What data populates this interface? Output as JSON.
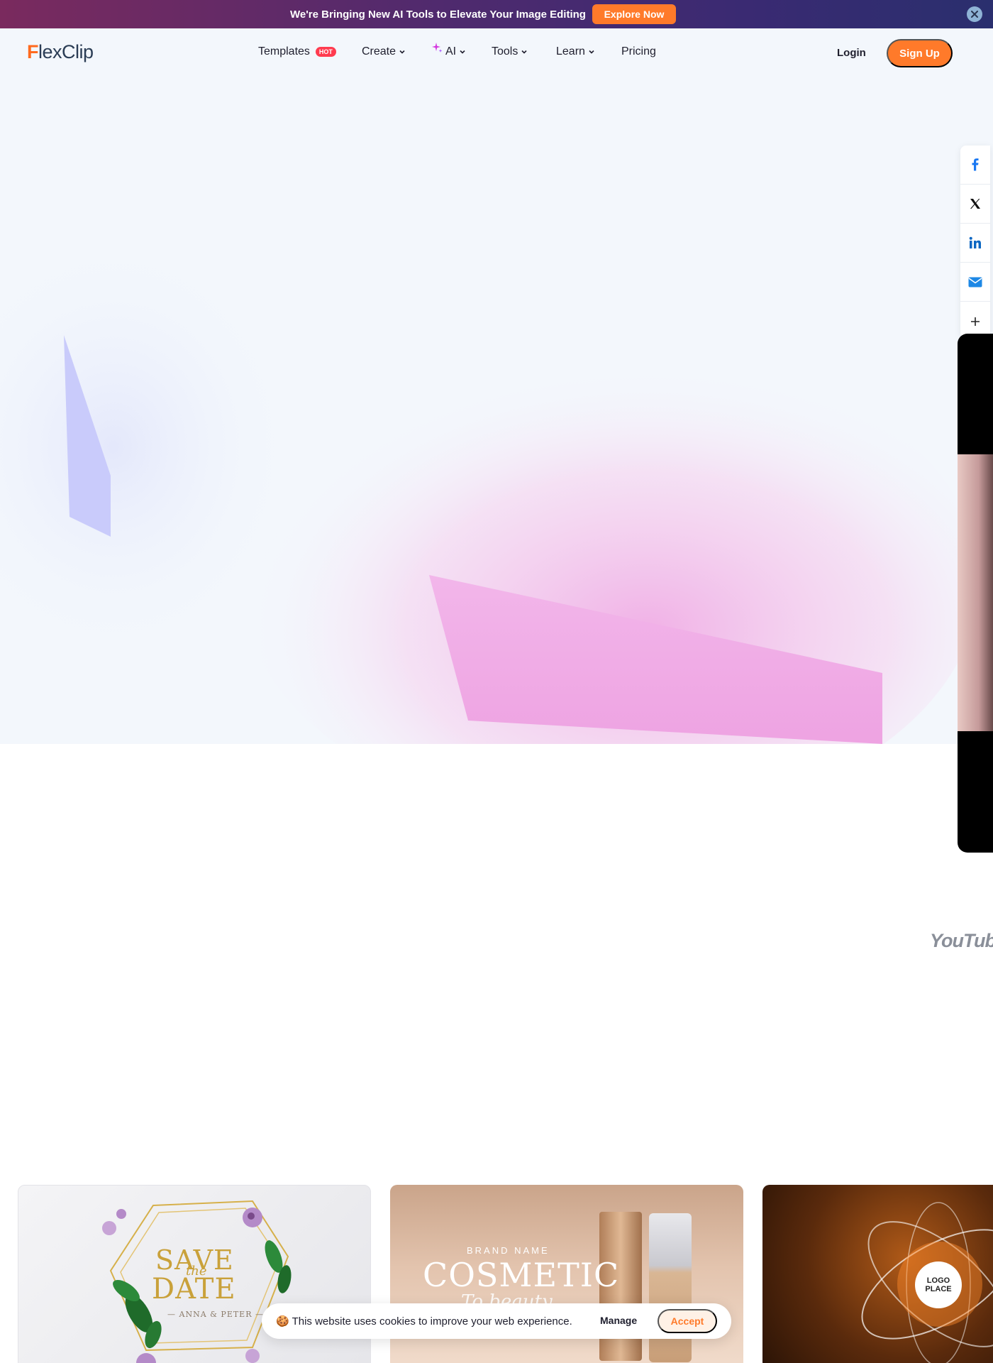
{
  "promo": {
    "text": "We're Bringing New AI Tools to Elevate Your Image Editing",
    "cta": "Explore Now"
  },
  "nav": {
    "logo_first": "F",
    "logo_rest": "lexClip",
    "items": [
      {
        "label": "Templates",
        "badge": "HOT"
      },
      {
        "label": "Create"
      },
      {
        "label": "AI"
      },
      {
        "label": "Tools"
      },
      {
        "label": "Learn"
      },
      {
        "label": "Pricing"
      }
    ],
    "login": "Login",
    "signup": "Sign Up"
  },
  "share": {
    "icons": [
      "facebook-icon",
      "x-icon",
      "linkedin-icon",
      "email-icon",
      "plus-icon"
    ]
  },
  "brand_strip": {
    "youtube": "YouTube"
  },
  "templates": [
    {
      "line1": "SAVE",
      "line2": "the",
      "line3": "DATE",
      "names": "— ANNA & PETER —"
    },
    {
      "brand": "BRAND NAME",
      "title": "COSMETIC",
      "subtitle": "To beauty"
    },
    {
      "logo_line1": "LOGO",
      "logo_line2": "PLACE"
    }
  ],
  "cookie": {
    "text": "This website uses cookies to improve your web experience.",
    "manage": "Manage",
    "accept": "Accept"
  },
  "colors": {
    "accent": "#ff7a2a",
    "hot": "#ff3b4f",
    "ai_sparkle": "#d43adf"
  }
}
